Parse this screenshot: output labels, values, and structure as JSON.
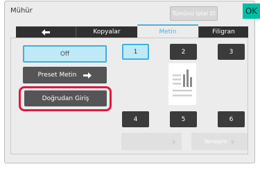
{
  "header": {
    "title": "Mühür",
    "cancel_all_label": "Tümünü İptal Et",
    "ok_label": "OK"
  },
  "tabs": [
    {
      "label": "Kopyalar",
      "active": false
    },
    {
      "label": "Metin",
      "active": true
    },
    {
      "label": "Filigran",
      "active": false
    }
  ],
  "left_panel": {
    "off_label": "Off",
    "preset_label": "Preset Metin",
    "direct_label": "Doğrudan Giriş"
  },
  "positions": [
    "1",
    "2",
    "3",
    "4",
    "5",
    "6"
  ],
  "selected_position": "1",
  "bottom": {
    "placement_label": "Yerleşim"
  },
  "colors": {
    "accent": "#3fb1dd",
    "ok": "#00bfa5",
    "highlight": "#d81b41"
  }
}
